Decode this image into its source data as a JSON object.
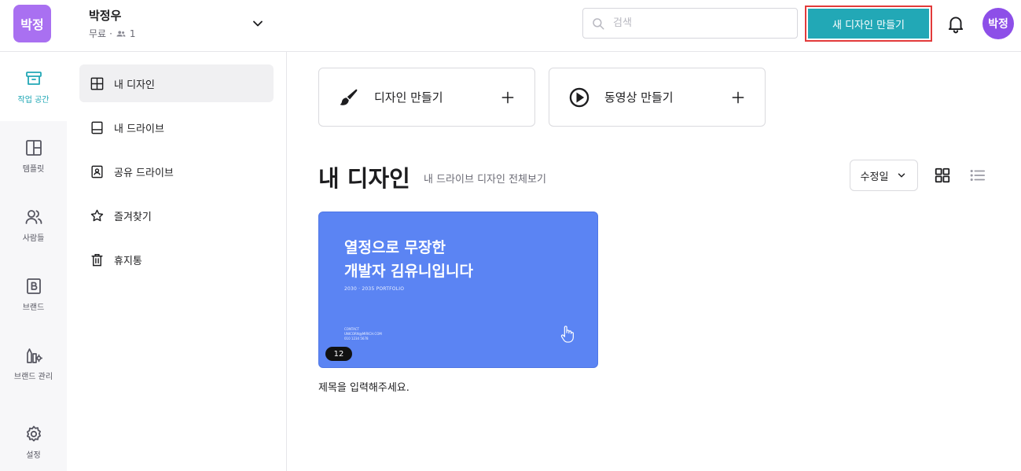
{
  "header": {
    "workspace_badge": "박정",
    "workspace_name": "박정우",
    "plan": "무료",
    "member_count": "1",
    "search_placeholder": "검색",
    "new_design_label": "새 디자인 만들기",
    "avatar_text": "박정"
  },
  "rail": {
    "items": [
      {
        "label": "작업 공간",
        "icon": "archive-icon",
        "active": true
      },
      {
        "label": "템플릿",
        "icon": "template-icon"
      },
      {
        "label": "사람들",
        "icon": "people-icon"
      },
      {
        "label": "브랜드",
        "icon": "brand-b-icon"
      },
      {
        "label": "브랜드 관리",
        "icon": "brand-manage-icon"
      },
      {
        "label": "설정",
        "icon": "gear-icon"
      }
    ]
  },
  "sidemenu": {
    "items": [
      {
        "label": "내 디자인",
        "icon": "layout-icon",
        "active": true
      },
      {
        "label": "내 드라이브",
        "icon": "drive-icon"
      },
      {
        "label": "공유 드라이브",
        "icon": "shared-drive-icon"
      },
      {
        "label": "즐겨찾기",
        "icon": "star-icon"
      },
      {
        "label": "휴지통",
        "icon": "trash-icon"
      }
    ]
  },
  "create": {
    "design_label": "디자인 만들기",
    "video_label": "동영상 만들기"
  },
  "section": {
    "title": "내 디자인",
    "subtitle": "내 드라이브 디자인 전체보기",
    "sort_label": "수정일"
  },
  "design": {
    "thumb_title": "열정으로 무장한\n개발자 김유니입니다",
    "thumb_subtitle": "2030 · 2035 PORTFOLIO",
    "thumb_contact_1": "CONTACT",
    "thumb_contact_2": "UNICORN@MIRICH.COM",
    "thumb_contact_3": "010 1234 5678",
    "page_count": "12",
    "title": "제목을 입력해주세요."
  },
  "colors": {
    "accent": "#22a8b6",
    "badge": "#a970f1",
    "avatar": "#8d4fe8",
    "thumb": "#5b84f3",
    "highlight_border": "#e23a3a"
  }
}
